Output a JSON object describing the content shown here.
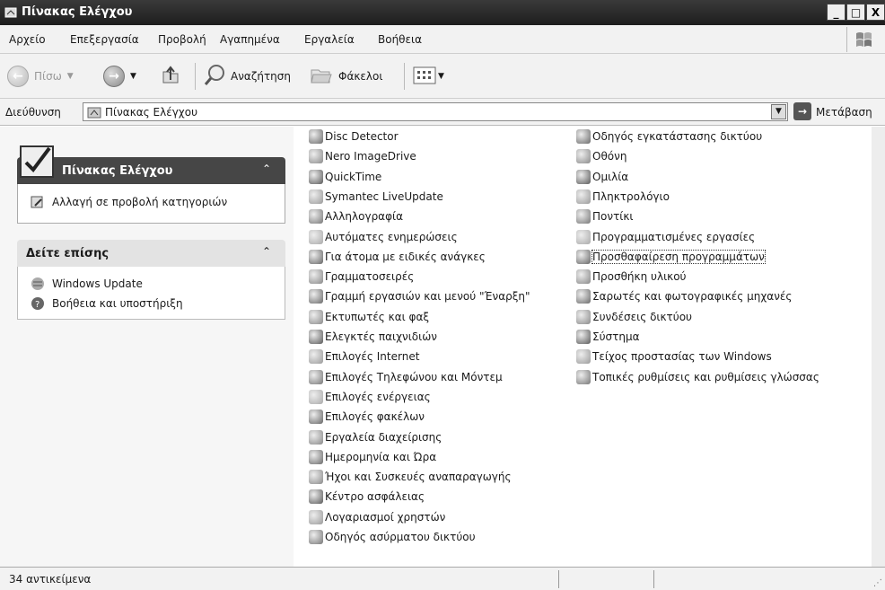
{
  "window": {
    "title": "Πίνακας Ελέγχου",
    "minimize": "_",
    "maximize": "□",
    "close": "X"
  },
  "menubar": [
    "Αρχείο",
    "Επεξεργασία",
    "Προβολή",
    "Αγαπημένα",
    "Εργαλεία",
    "Βοήθεια"
  ],
  "toolbar": {
    "back": "Πίσω",
    "search": "Αναζήτηση",
    "folders": "Φάκελοι"
  },
  "address": {
    "label": "Διεύθυνση",
    "value": "Πίνακας Ελέγχου",
    "go": "Μετάβαση"
  },
  "sidebar": {
    "panel_title": "Πίνακας Ελέγχου",
    "switch_view": "Αλλαγή σε προβολή κατηγοριών",
    "see_also_title": "Δείτε επίσης",
    "see_also": [
      "Windows Update",
      "Βοήθεια και υποστήριξη"
    ],
    "collapse_glyph": "⌃"
  },
  "items_col1": [
    "Disc Detector",
    "Nero ImageDrive",
    "QuickTime",
    "Symantec LiveUpdate",
    "Αλληλογραφία",
    "Αυτόματες ενημερώσεις",
    "Για άτομα με ειδικές ανάγκες",
    "Γραμματοσειρές",
    "Γραμμή εργασιών και μενού \"Έναρξη\"",
    "Εκτυπωτές και φαξ",
    "Ελεγκτές παιχνιδιών",
    "Επιλογές Internet",
    "Επιλογές Τηλεφώνου και Μόντεμ",
    "Επιλογές ενέργειας",
    "Επιλογές φακέλων",
    "Εργαλεία διαχείρισης",
    "Ημερομηνία και Ώρα",
    "Ήχοι και Συσκευές αναπαραγωγής",
    "Κέντρο ασφάλειας",
    "Λογαριασμοί χρηστών",
    "Οδηγός ασύρματου δικτύου"
  ],
  "items_col2": [
    "Οδηγός εγκατάστασης δικτύου",
    "Οθόνη",
    "Ομιλία",
    "Πληκτρολόγιο",
    "Ποντίκι",
    "Προγραμματισμένες εργασίες",
    "Προσθαφαίρεση προγραμμάτων",
    "Προσθήκη υλικού",
    "Σαρωτές και φωτογραφικές μηχανές",
    "Συνδέσεις δικτύου",
    "Σύστημα",
    "Τείχος προστασίας των Windows",
    "Τοπικές ρυθμίσεις και ρυθμίσεις γλώσσας"
  ],
  "focused_item": "Προσθαφαίρεση προγραμμάτων",
  "status": {
    "count": "34 αντικείμενα"
  }
}
